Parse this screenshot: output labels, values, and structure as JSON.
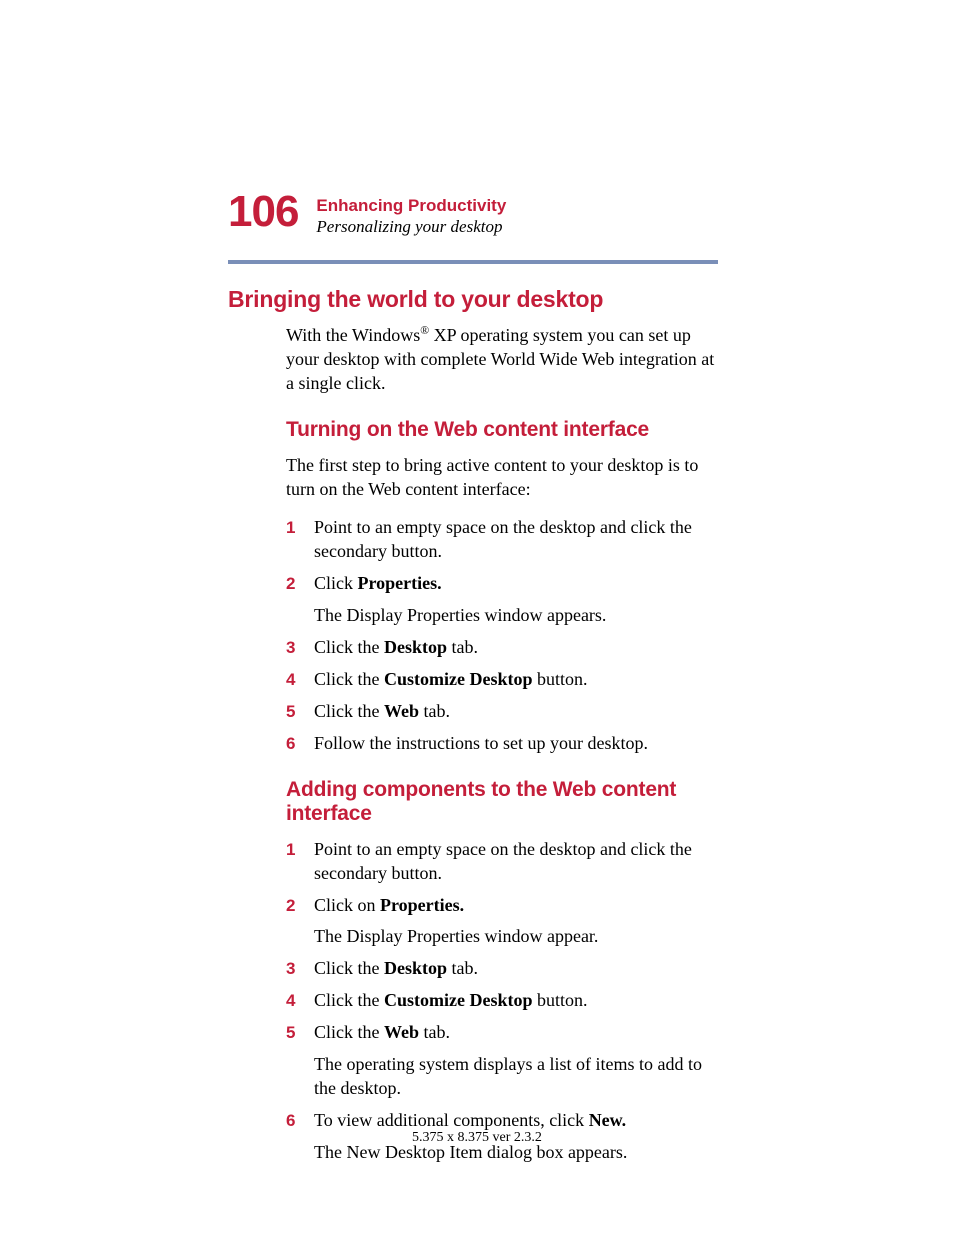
{
  "page_number": "106",
  "chapter_title": "Enhancing Productivity",
  "section_sub": "Personalizing your desktop",
  "h1": "Bringing the world to your desktop",
  "intro_html": "With the Windows<sup>®</sup> XP operating system you can set up your desktop with complete World Wide Web integration at a single click.",
  "sec1": {
    "title": "Turning on the Web content interface",
    "intro": "The first step to bring active content to your desktop is to turn on the Web content interface:",
    "steps": [
      {
        "n": "1",
        "html": "Point to an empty space on the desktop and click the secondary button."
      },
      {
        "n": "2",
        "html": "Click <b>Properties.</b>",
        "after": "The Display Properties window appears."
      },
      {
        "n": "3",
        "html": "Click the <b>Desktop</b> tab."
      },
      {
        "n": "4",
        "html": "Click the <b>Customize Desktop</b> button."
      },
      {
        "n": "5",
        "html": "Click the <b>Web</b> tab."
      },
      {
        "n": "6",
        "html": "Follow the instructions to set up your desktop."
      }
    ]
  },
  "sec2": {
    "title": "Adding components to the Web content interface",
    "steps": [
      {
        "n": "1",
        "html": "Point to an empty space on the desktop and click the secondary button."
      },
      {
        "n": "2",
        "html": "Click on <b>Properties.</b>",
        "after": "The Display Properties window appear."
      },
      {
        "n": "3",
        "html": "Click the <b>Desktop</b> tab."
      },
      {
        "n": "4",
        "html": "Click the <b>Customize Desktop</b> button."
      },
      {
        "n": "5",
        "html": "Click the <b>Web</b> tab.",
        "after": "The operating system displays a list of items to add to the desktop."
      },
      {
        "n": "6",
        "html": "To view additional components, click <b>New.</b>",
        "after": "The New Desktop Item dialog box appears."
      }
    ]
  },
  "footer": "5.375 x 8.375 ver 2.3.2"
}
